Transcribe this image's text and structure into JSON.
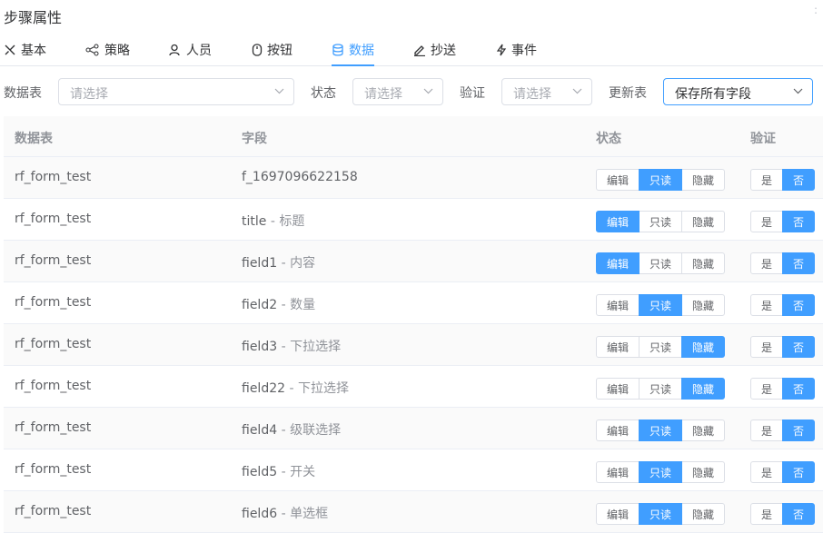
{
  "panel": {
    "title": "步骤属性"
  },
  "tabs": [
    {
      "label": "基本",
      "icon": "tools-icon"
    },
    {
      "label": "策略",
      "icon": "share-icon"
    },
    {
      "label": "人员",
      "icon": "user-icon"
    },
    {
      "label": "按钮",
      "icon": "mouse-icon"
    },
    {
      "label": "数据",
      "icon": "database-icon",
      "active": true
    },
    {
      "label": "抄送",
      "icon": "edit-icon"
    },
    {
      "label": "事件",
      "icon": "lightning-icon"
    }
  ],
  "filters": {
    "table_label": "数据表",
    "table_placeholder": "请选择",
    "status_label": "状态",
    "status_placeholder": "请选择",
    "verify_label": "验证",
    "verify_placeholder": "请选择",
    "update_label": "更新表",
    "update_value": "保存所有字段"
  },
  "columns": {
    "table": "数据表",
    "field": "字段",
    "status": "状态",
    "verify": "验证"
  },
  "status_options": [
    "编辑",
    "只读",
    "隐藏"
  ],
  "verify_options": [
    "是",
    "否"
  ],
  "rows": [
    {
      "table": "rf_form_test",
      "field": "f_1697096622158",
      "desc": "",
      "status": "只读",
      "verify": "否"
    },
    {
      "table": "rf_form_test",
      "field": "title",
      "desc": "标题",
      "status": "编辑",
      "verify": "否"
    },
    {
      "table": "rf_form_test",
      "field": "field1",
      "desc": "内容",
      "status": "编辑",
      "verify": "否"
    },
    {
      "table": "rf_form_test",
      "field": "field2",
      "desc": "数量",
      "status": "只读",
      "verify": "否"
    },
    {
      "table": "rf_form_test",
      "field": "field3",
      "desc": "下拉选择",
      "status": "隐藏",
      "verify": "否"
    },
    {
      "table": "rf_form_test",
      "field": "field22",
      "desc": "下拉选择",
      "status": "隐藏",
      "verify": "否"
    },
    {
      "table": "rf_form_test",
      "field": "field4",
      "desc": "级联选择",
      "status": "只读",
      "verify": "否"
    },
    {
      "table": "rf_form_test",
      "field": "field5",
      "desc": "开关",
      "status": "只读",
      "verify": "否"
    },
    {
      "table": "rf_form_test",
      "field": "field6",
      "desc": "单选框",
      "status": "只读",
      "verify": "否"
    }
  ],
  "colors": {
    "accent": "#409eff"
  }
}
